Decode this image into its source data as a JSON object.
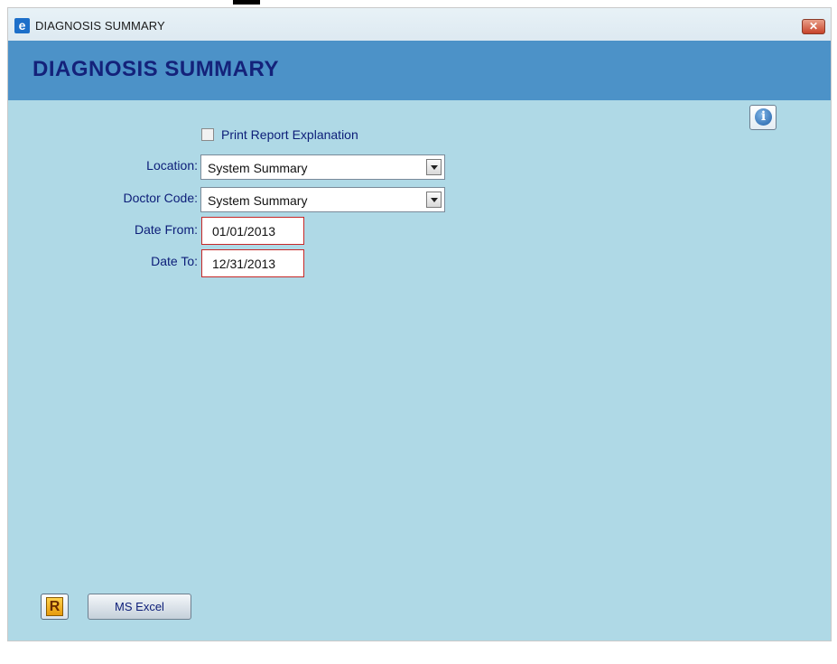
{
  "window": {
    "title": "DIAGNOSIS SUMMARY",
    "app_icon": "e-app-icon",
    "close_icon": "close-icon"
  },
  "header": {
    "title": "DIAGNOSIS SUMMARY"
  },
  "form": {
    "print_explanation": {
      "label": "Print Report Explanation",
      "checked": false
    },
    "location": {
      "label": "Location:",
      "value": "System Summary"
    },
    "doctor_code": {
      "label": "Doctor Code:",
      "value": "System Summary"
    },
    "date_from": {
      "label": "Date From:",
      "value": "01/01/2013"
    },
    "date_to": {
      "label": "Date To:",
      "value": "12/31/2013"
    }
  },
  "buttons": {
    "info_icon": "info-icon",
    "report_icon": "report-icon",
    "report_glyph": "R",
    "excel_label": "MS Excel"
  },
  "colors": {
    "background": "#afd9e6",
    "header_band": "#4c92c8",
    "title_text": "#14227a",
    "invalid_border": "#c62828"
  }
}
